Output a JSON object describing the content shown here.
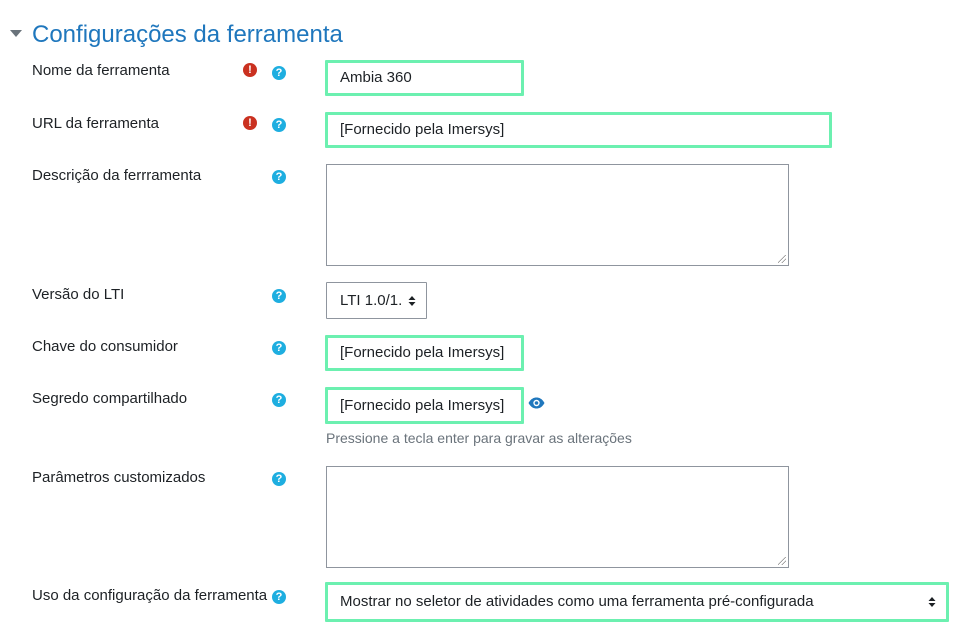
{
  "section": {
    "title": "Configurações da ferramenta"
  },
  "fields": {
    "tool_name": {
      "label": "Nome da ferramenta",
      "value": "Ambia 360"
    },
    "tool_url": {
      "label": "URL da ferramenta",
      "value": "[Fornecido pela Imersys]"
    },
    "tool_description": {
      "label": "Descrição da ferrramenta",
      "value": ""
    },
    "lti_version": {
      "label": "Versão do LTI",
      "value": "LTI 1.0/1."
    },
    "consumer_key": {
      "label": "Chave do consumidor",
      "value": "[Fornecido pela Imersys]"
    },
    "shared_secret": {
      "label": "Segredo compartilhado",
      "value": "[Fornecido pela Imersys]",
      "hint": "Pressione a tecla enter para gravar as alterações"
    },
    "custom_params": {
      "label": "Parâmetros customizados",
      "value": ""
    },
    "config_usage": {
      "label": "Uso da configuração da ferramenta",
      "value": "Mostrar no seletor de atividades como uma ferramenta pré-configurada"
    }
  },
  "icons": {
    "required": "exclamation-circle-icon",
    "help": "question-circle-icon",
    "reveal": "eye-icon",
    "collapse": "caret-down-icon"
  },
  "colors": {
    "title": "#1f77bd",
    "required": "#ca3120",
    "help": "#1eaee0",
    "highlight": "#6cf0b0"
  }
}
